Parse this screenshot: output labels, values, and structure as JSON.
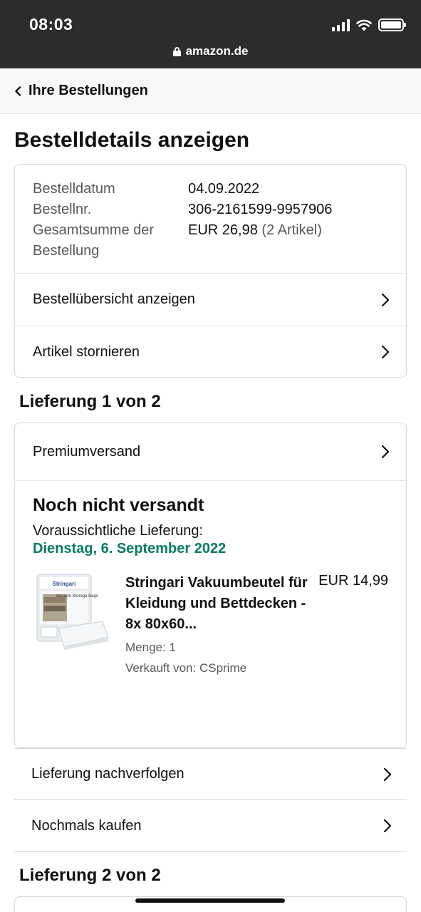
{
  "status_bar": {
    "time": "08:03",
    "url": "amazon.de"
  },
  "breadcrumb": {
    "label": "Ihre Bestellungen"
  },
  "page_title": "Bestelldetails anzeigen",
  "order": {
    "date_label": "Bestelldatum",
    "date_value": "04.09.2022",
    "number_label": "Bestellnr.",
    "number_value": "306-2161599-9957906",
    "total_label": "Gesamtsumme der Bestellung",
    "total_value": "EUR 26,98",
    "total_count": "(2 Artikel)",
    "links": [
      {
        "label": "Bestellübersicht anzeigen"
      },
      {
        "label": "Artikel stornieren"
      }
    ]
  },
  "delivery1": {
    "title": "Lieferung 1 von 2",
    "shipping": "Premiumversand",
    "status": "Noch nicht versandt",
    "eta_label": "Voraussichtliche Lieferung:",
    "eta_date": "Dienstag, 6. September 2022",
    "item": {
      "image": "vacuum-storage-bags-product-image",
      "title": "Stringari Vakuumbeutel für Kleidung und Bettdecken - 8x 80x60...",
      "quantity": "Menge: 1",
      "seller": "Verkauft von: CSprime",
      "price": "EUR 14,99",
      "brand_text": "Stringari",
      "package_text": "Vacuum Storage Bags"
    },
    "actions": [
      {
        "label": "Lieferung nachverfolgen"
      },
      {
        "label": "Nochmals kaufen"
      }
    ]
  },
  "delivery2": {
    "title": "Lieferung 2 von 2"
  },
  "colors": {
    "eta_green": "#067d62",
    "top_bar": "#2c2c2c",
    "border": "#d5d9d9"
  }
}
